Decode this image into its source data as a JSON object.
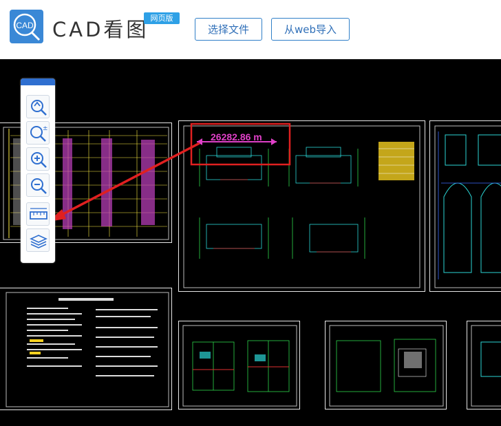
{
  "header": {
    "logo_abbr": "CAD",
    "app_title": "CAD看图",
    "badge": "网页版",
    "select_file_label": "选择文件",
    "web_import_label": "从web导入"
  },
  "toolbar": {
    "tools": [
      {
        "name": "zoom-extents",
        "icon": "zoom-fit-icon"
      },
      {
        "name": "zoom-window",
        "icon": "zoom-window-icon"
      },
      {
        "name": "zoom-in",
        "icon": "zoom-in-icon"
      },
      {
        "name": "zoom-out",
        "icon": "zoom-out-icon"
      },
      {
        "name": "measure",
        "icon": "ruler-icon"
      },
      {
        "name": "layers",
        "icon": "layers-icon"
      }
    ]
  },
  "drawing": {
    "measure_label": "26282.86 m",
    "colors": {
      "background": "#000000",
      "accent": "#2f6fd0",
      "measure": "#e040c8",
      "highlight": "#e02020"
    }
  }
}
